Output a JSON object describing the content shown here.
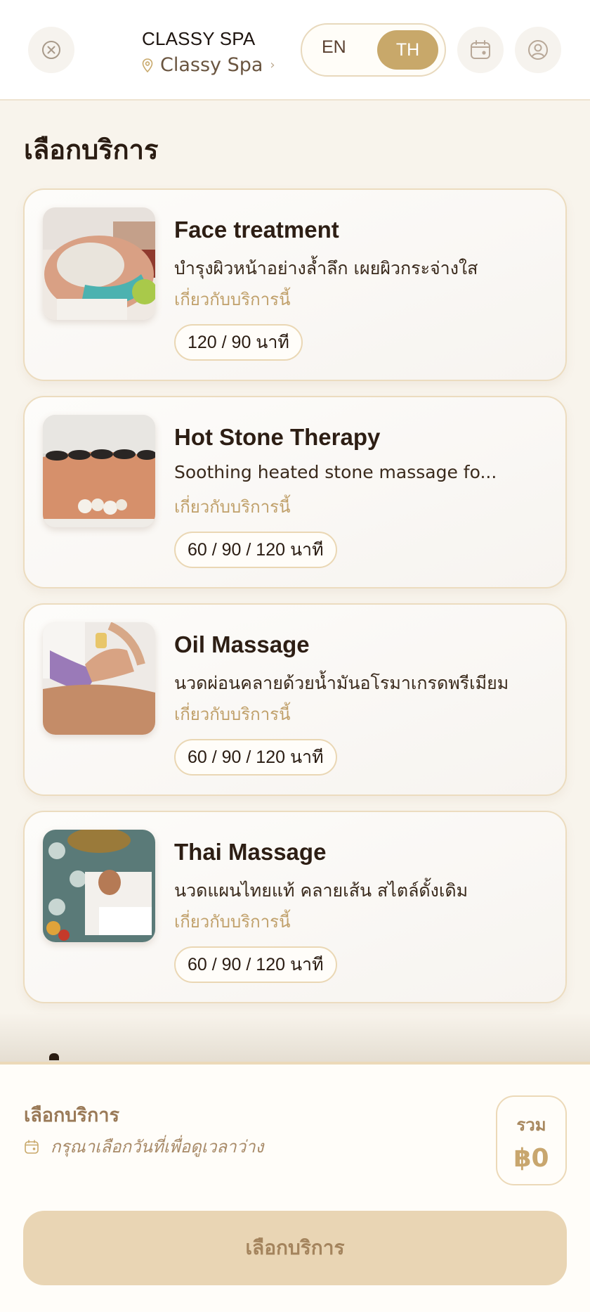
{
  "header": {
    "brand_name": "CLASSY SPA",
    "location_name": "Classy Spa",
    "lang_en": "EN",
    "lang_th": "TH",
    "active_lang": "TH",
    "icons": [
      "close-icon",
      "location-pin-icon",
      "chevron-right-icon",
      "calendar-icon",
      "user-icon"
    ]
  },
  "main": {
    "section_title": "เลือกบริการ",
    "services": [
      {
        "title": "Face treatment",
        "description": "บำรุงผิวหน้าอย่างล้ำลึก เผยผิวกระจ่างใส",
        "link": "เกี่ยวกับบริการนี้",
        "durations": "120 / 90 นาที"
      },
      {
        "title": "Hot Stone Therapy",
        "description": "Soothing heated stone massage fo...",
        "link": "เกี่ยวกับบริการนี้",
        "durations": "60 / 90 / 120 นาที"
      },
      {
        "title": "Oil Massage",
        "description": "นวดผ่อนคลายด้วยน้ำมันอโรมาเกรดพรีเมียม",
        "link": "เกี่ยวกับบริการนี้",
        "durations": "60 / 90 / 120 นาที"
      },
      {
        "title": "Thai Massage",
        "description": "นวดแผนไทยแท้ คลายเส้น สไตล์ดั้งเดิม",
        "link": "เกี่ยวกับบริการนี้",
        "durations": "60 / 90 / 120 นาที"
      }
    ]
  },
  "bottom": {
    "title": "เลือกบริการ",
    "hint": "กรุณาเลือกวันที่เพื่อดูเวลาว่าง",
    "total_label": "รวม",
    "total_value": "฿0",
    "cta_label": "เลือกบริการ"
  },
  "colors": {
    "accent": "#c8a86a",
    "background": "#f8f4ec",
    "cta_disabled": "#e9d5b4"
  }
}
